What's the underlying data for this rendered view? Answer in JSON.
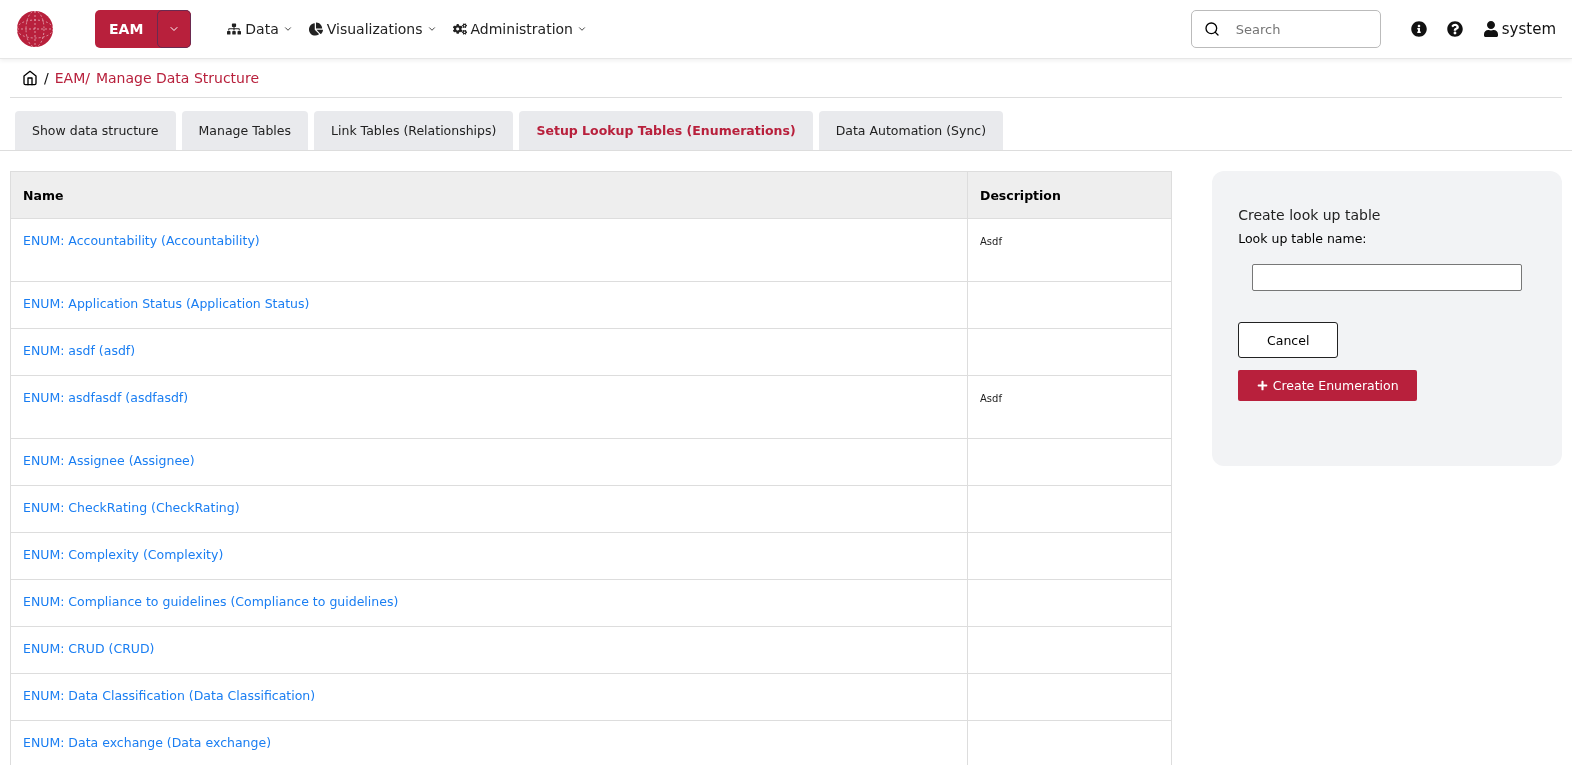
{
  "header": {
    "app_button": "EAM",
    "nav": [
      {
        "label": "Data"
      },
      {
        "label": "Visualizations"
      },
      {
        "label": "Administration"
      }
    ],
    "search": {
      "placeholder": "Search"
    },
    "user": "system"
  },
  "breadcrumb_separator": "/",
  "breadcrumb": [
    "EAM/",
    "Manage Data Structure"
  ],
  "tabs": [
    {
      "label": "Show data structure",
      "selected": false
    },
    {
      "label": "Manage Tables",
      "selected": false
    },
    {
      "label": "Link Tables (Relationships)",
      "selected": false
    },
    {
      "label": "Setup Lookup Tables (Enumerations)",
      "selected": true
    },
    {
      "label": "Data Automation (Sync)",
      "selected": false
    }
  ],
  "table": {
    "columns": [
      "Name",
      "Description"
    ],
    "rows": [
      {
        "name": "ENUM: Accountability (Accountability)",
        "description": "Asdf"
      },
      {
        "name": "ENUM: Application Status (Application Status)"
      },
      {
        "name": "ENUM: asdf (asdf)"
      },
      {
        "name": "ENUM: asdfasdf (asdfasdf)",
        "description": "Asdf"
      },
      {
        "name": "ENUM: Assignee (Assignee)"
      },
      {
        "name": "ENUM: CheckRating (CheckRating)"
      },
      {
        "name": "ENUM: Complexity (Complexity)"
      },
      {
        "name": "ENUM: Compliance to guidelines (Compliance to guidelines)"
      },
      {
        "name": "ENUM: CRUD (CRUD)"
      },
      {
        "name": "ENUM: Data Classification (Data Classification)"
      },
      {
        "name": "ENUM: Data exchange (Data exchange)"
      }
    ]
  },
  "panel": {
    "title": "Create look up table",
    "field_label": "Look up table name:",
    "cancel": "Cancel",
    "create": "Create Enumeration"
  }
}
